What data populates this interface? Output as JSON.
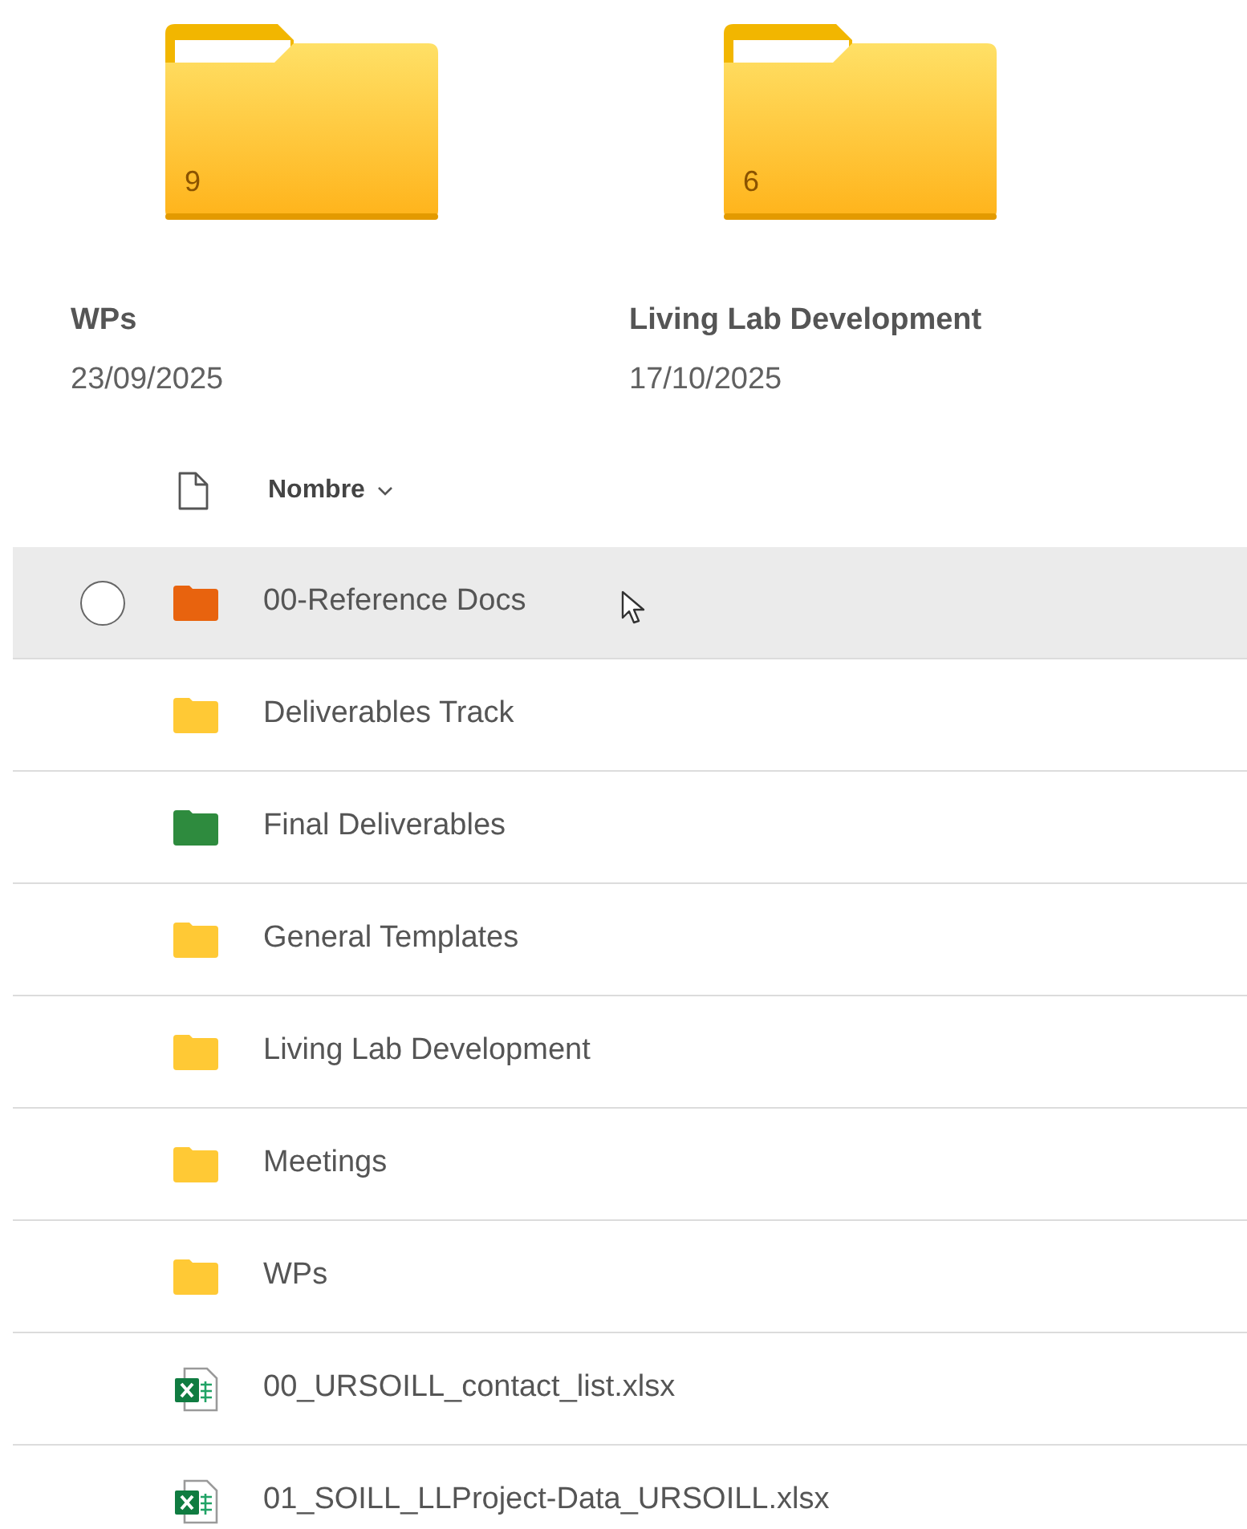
{
  "tiles": [
    {
      "count": "9",
      "name": "WPs",
      "date": "23/09/2025"
    },
    {
      "count": "6",
      "name": "Living Lab Development",
      "date": "17/10/2025"
    }
  ],
  "header": {
    "column": "Nombre"
  },
  "rows": [
    {
      "kind": "folder",
      "name": "00-Reference Docs",
      "color": "#e8630e",
      "hovered": true
    },
    {
      "kind": "folder",
      "name": "Deliverables Track",
      "color": "#ffc935",
      "hovered": false
    },
    {
      "kind": "folder",
      "name": "Final Deliverables",
      "color": "#2e8b3e",
      "hovered": false
    },
    {
      "kind": "folder",
      "name": "General Templates",
      "color": "#ffc935",
      "hovered": false
    },
    {
      "kind": "folder",
      "name": "Living Lab Development",
      "color": "#ffc935",
      "hovered": false
    },
    {
      "kind": "folder",
      "name": "Meetings",
      "color": "#ffc935",
      "hovered": false
    },
    {
      "kind": "folder",
      "name": "WPs",
      "color": "#ffc935",
      "hovered": false
    },
    {
      "kind": "spreadsheet",
      "name": "00_URSOILL_contact_list.xlsx",
      "hovered": false
    },
    {
      "kind": "spreadsheet",
      "name": "01_SOILL_LLProject-Data_URSOILL.xlsx",
      "hovered": false
    }
  ]
}
